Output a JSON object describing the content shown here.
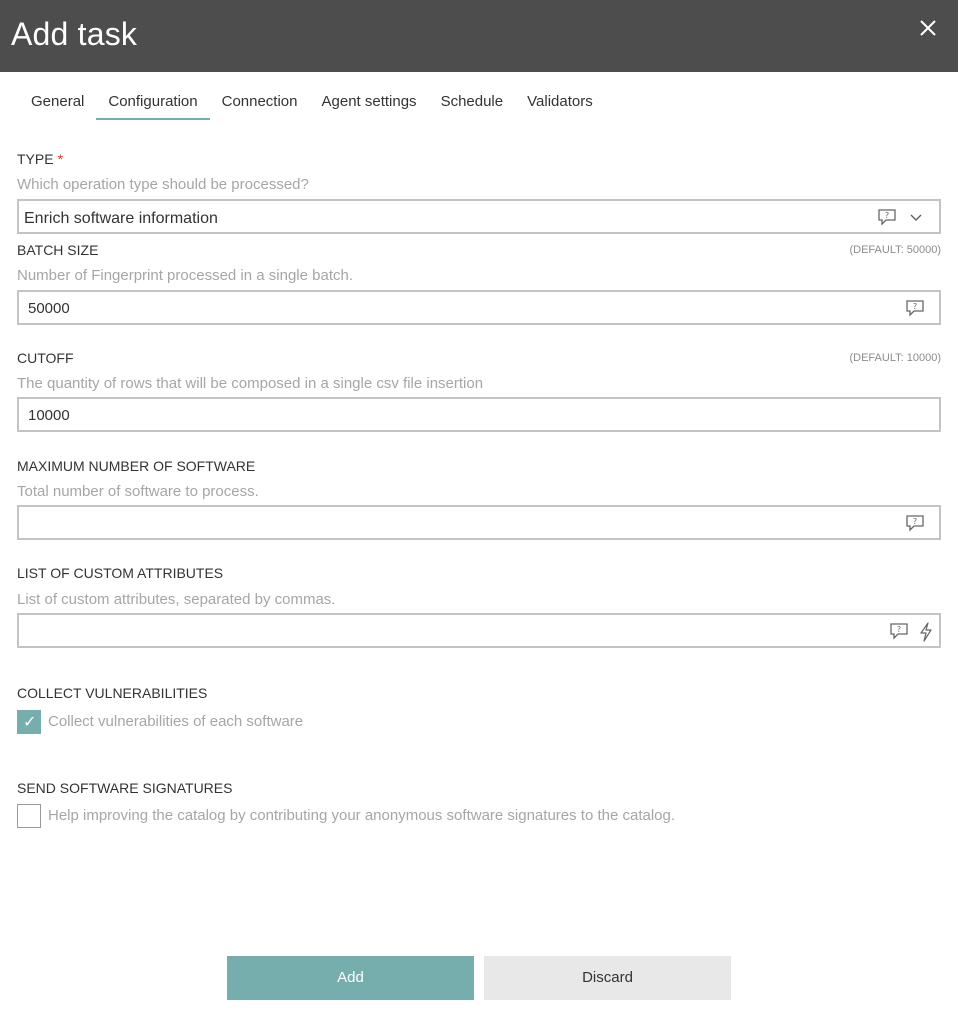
{
  "header": {
    "title": "Add task"
  },
  "tabs": [
    {
      "label": "General"
    },
    {
      "label": "Configuration",
      "active": true
    },
    {
      "label": "Connection"
    },
    {
      "label": "Agent settings"
    },
    {
      "label": "Schedule"
    },
    {
      "label": "Validators"
    }
  ],
  "type_field": {
    "label": "TYPE",
    "required_mark": "*",
    "description": "Which operation type should be processed?",
    "value": "Enrich software information"
  },
  "batch_size": {
    "label": "BATCH SIZE",
    "default": "(DEFAULT: 50000)",
    "description": "Number of Fingerprint processed in a single batch.",
    "value": "50000"
  },
  "cutoff": {
    "label": "CUTOFF",
    "default": "(DEFAULT: 10000)",
    "description": "The quantity of rows that will be composed in a single csv file insertion",
    "value": "10000"
  },
  "max_software": {
    "label": "MAXIMUM NUMBER OF SOFTWARE",
    "description": "Total number of software to process.",
    "value": ""
  },
  "custom_attributes": {
    "label": "LIST OF CUSTOM ATTRIBUTES",
    "description": "List of custom attributes, separated by commas.",
    "value": ""
  },
  "collect_vulnerabilities": {
    "label": "COLLECT VULNERABILITIES",
    "checkbox_label": "Collect vulnerabilities of each software",
    "checked": true
  },
  "send_signatures": {
    "label": "SEND SOFTWARE SIGNATURES",
    "checkbox_label": "Help improving the catalog by contributing your anonymous software signatures to the catalog.",
    "checked": false
  },
  "buttons": {
    "add": "Add",
    "discard": "Discard"
  },
  "colors": {
    "header_bg": "#4d4d4d",
    "accent": "#76aeae",
    "required": "#d9342b"
  },
  "icons": [
    "close-icon",
    "help-comment-icon",
    "chevron-down-icon",
    "lightning-icon",
    "checkmark-icon"
  ]
}
